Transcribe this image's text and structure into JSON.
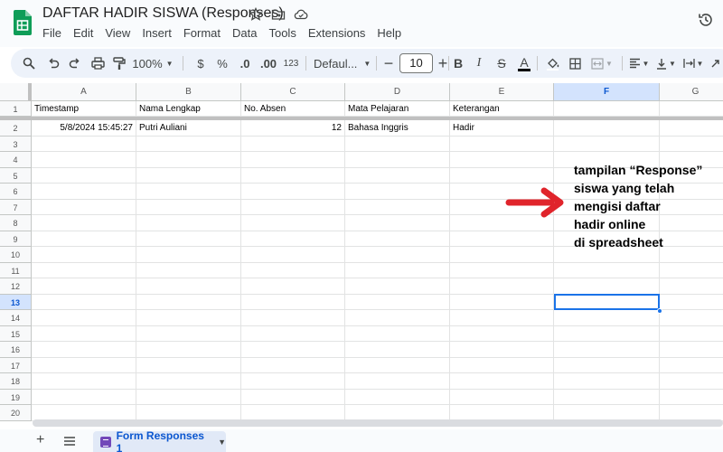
{
  "app": {
    "title": "DAFTAR HADIR SISWA (Responses)",
    "brand_color": "#0f9d58",
    "menu": [
      "File",
      "Edit",
      "View",
      "Insert",
      "Format",
      "Data",
      "Tools",
      "Extensions",
      "Help"
    ]
  },
  "toolbar": {
    "zoom": "100%",
    "currency": "$",
    "percent": "%",
    "decrease_decimal": ".0",
    "increase_decimal": ".00",
    "number_format": "123",
    "font": "Defaul...",
    "font_size": "10"
  },
  "sheet": {
    "columns": [
      "A",
      "B",
      "C",
      "D",
      "E",
      "F",
      "G"
    ],
    "rows": [
      "1",
      "2",
      "3",
      "4",
      "5",
      "6",
      "7",
      "8",
      "9",
      "10",
      "11",
      "12",
      "13",
      "14",
      "15",
      "16",
      "17",
      "18",
      "19",
      "20"
    ],
    "headers": [
      "Timestamp",
      "Nama Lengkap",
      "No. Absen",
      "Mata Pelajaran",
      "Keterangan"
    ],
    "data_row": [
      "5/8/2024 15:45:27",
      "Putri Auliani",
      "12",
      "Bahasa Inggris",
      "Hadir"
    ],
    "active_column": "F",
    "active_row": "13",
    "selection_color": "#1a73e8"
  },
  "annotation": {
    "lines": [
      "tampilan “Response”",
      "siswa yang telah",
      "mengisi daftar",
      "hadir online",
      "di spreadsheet"
    ],
    "arrow_color": "#e0242b"
  },
  "tabs": {
    "add": "+",
    "active_tab": "Form Responses 1"
  }
}
